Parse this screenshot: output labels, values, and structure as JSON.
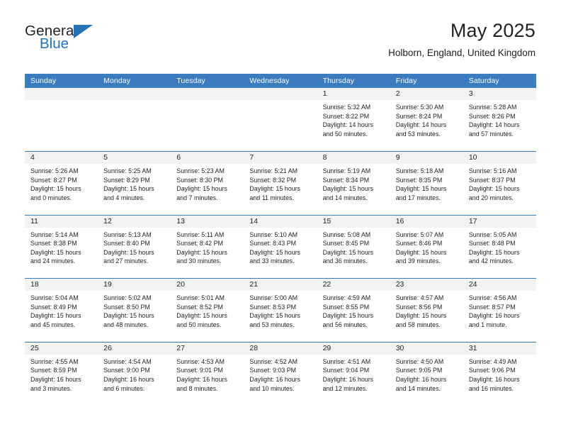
{
  "logo": {
    "word_one": "General",
    "word_two": "Blue",
    "triangle_icon": "triangle-icon",
    "accent_color": "#2572b5"
  },
  "header": {
    "title": "May 2025",
    "subtitle": "Holborn, England, United Kingdom"
  },
  "calendar": {
    "header_bg": "#3a7cbe",
    "daystrip_bg": "#f2f2f2",
    "weekday_headers": [
      "Sunday",
      "Monday",
      "Tuesday",
      "Wednesday",
      "Thursday",
      "Friday",
      "Saturday"
    ],
    "weeks": [
      [
        {
          "day": "",
          "empty": true
        },
        {
          "day": "",
          "empty": true
        },
        {
          "day": "",
          "empty": true
        },
        {
          "day": "",
          "empty": true
        },
        {
          "day": "1",
          "sunrise": "Sunrise: 5:32 AM",
          "sunset": "Sunset: 8:22 PM",
          "daylight_1": "Daylight: 14 hours",
          "daylight_2": "and 50 minutes."
        },
        {
          "day": "2",
          "sunrise": "Sunrise: 5:30 AM",
          "sunset": "Sunset: 8:24 PM",
          "daylight_1": "Daylight: 14 hours",
          "daylight_2": "and 53 minutes."
        },
        {
          "day": "3",
          "sunrise": "Sunrise: 5:28 AM",
          "sunset": "Sunset: 8:26 PM",
          "daylight_1": "Daylight: 14 hours",
          "daylight_2": "and 57 minutes."
        }
      ],
      [
        {
          "day": "4",
          "sunrise": "Sunrise: 5:26 AM",
          "sunset": "Sunset: 8:27 PM",
          "daylight_1": "Daylight: 15 hours",
          "daylight_2": "and 0 minutes."
        },
        {
          "day": "5",
          "sunrise": "Sunrise: 5:25 AM",
          "sunset": "Sunset: 8:29 PM",
          "daylight_1": "Daylight: 15 hours",
          "daylight_2": "and 4 minutes."
        },
        {
          "day": "6",
          "sunrise": "Sunrise: 5:23 AM",
          "sunset": "Sunset: 8:30 PM",
          "daylight_1": "Daylight: 15 hours",
          "daylight_2": "and 7 minutes."
        },
        {
          "day": "7",
          "sunrise": "Sunrise: 5:21 AM",
          "sunset": "Sunset: 8:32 PM",
          "daylight_1": "Daylight: 15 hours",
          "daylight_2": "and 11 minutes."
        },
        {
          "day": "8",
          "sunrise": "Sunrise: 5:19 AM",
          "sunset": "Sunset: 8:34 PM",
          "daylight_1": "Daylight: 15 hours",
          "daylight_2": "and 14 minutes."
        },
        {
          "day": "9",
          "sunrise": "Sunrise: 5:18 AM",
          "sunset": "Sunset: 8:35 PM",
          "daylight_1": "Daylight: 15 hours",
          "daylight_2": "and 17 minutes."
        },
        {
          "day": "10",
          "sunrise": "Sunrise: 5:16 AM",
          "sunset": "Sunset: 8:37 PM",
          "daylight_1": "Daylight: 15 hours",
          "daylight_2": "and 20 minutes."
        }
      ],
      [
        {
          "day": "11",
          "sunrise": "Sunrise: 5:14 AM",
          "sunset": "Sunset: 8:38 PM",
          "daylight_1": "Daylight: 15 hours",
          "daylight_2": "and 24 minutes."
        },
        {
          "day": "12",
          "sunrise": "Sunrise: 5:13 AM",
          "sunset": "Sunset: 8:40 PM",
          "daylight_1": "Daylight: 15 hours",
          "daylight_2": "and 27 minutes."
        },
        {
          "day": "13",
          "sunrise": "Sunrise: 5:11 AM",
          "sunset": "Sunset: 8:42 PM",
          "daylight_1": "Daylight: 15 hours",
          "daylight_2": "and 30 minutes."
        },
        {
          "day": "14",
          "sunrise": "Sunrise: 5:10 AM",
          "sunset": "Sunset: 8:43 PM",
          "daylight_1": "Daylight: 15 hours",
          "daylight_2": "and 33 minutes."
        },
        {
          "day": "15",
          "sunrise": "Sunrise: 5:08 AM",
          "sunset": "Sunset: 8:45 PM",
          "daylight_1": "Daylight: 15 hours",
          "daylight_2": "and 36 minutes."
        },
        {
          "day": "16",
          "sunrise": "Sunrise: 5:07 AM",
          "sunset": "Sunset: 8:46 PM",
          "daylight_1": "Daylight: 15 hours",
          "daylight_2": "and 39 minutes."
        },
        {
          "day": "17",
          "sunrise": "Sunrise: 5:05 AM",
          "sunset": "Sunset: 8:48 PM",
          "daylight_1": "Daylight: 15 hours",
          "daylight_2": "and 42 minutes."
        }
      ],
      [
        {
          "day": "18",
          "sunrise": "Sunrise: 5:04 AM",
          "sunset": "Sunset: 8:49 PM",
          "daylight_1": "Daylight: 15 hours",
          "daylight_2": "and 45 minutes."
        },
        {
          "day": "19",
          "sunrise": "Sunrise: 5:02 AM",
          "sunset": "Sunset: 8:50 PM",
          "daylight_1": "Daylight: 15 hours",
          "daylight_2": "and 48 minutes."
        },
        {
          "day": "20",
          "sunrise": "Sunrise: 5:01 AM",
          "sunset": "Sunset: 8:52 PM",
          "daylight_1": "Daylight: 15 hours",
          "daylight_2": "and 50 minutes."
        },
        {
          "day": "21",
          "sunrise": "Sunrise: 5:00 AM",
          "sunset": "Sunset: 8:53 PM",
          "daylight_1": "Daylight: 15 hours",
          "daylight_2": "and 53 minutes."
        },
        {
          "day": "22",
          "sunrise": "Sunrise: 4:59 AM",
          "sunset": "Sunset: 8:55 PM",
          "daylight_1": "Daylight: 15 hours",
          "daylight_2": "and 56 minutes."
        },
        {
          "day": "23",
          "sunrise": "Sunrise: 4:57 AM",
          "sunset": "Sunset: 8:56 PM",
          "daylight_1": "Daylight: 15 hours",
          "daylight_2": "and 58 minutes."
        },
        {
          "day": "24",
          "sunrise": "Sunrise: 4:56 AM",
          "sunset": "Sunset: 8:57 PM",
          "daylight_1": "Daylight: 16 hours",
          "daylight_2": "and 1 minute."
        }
      ],
      [
        {
          "day": "25",
          "sunrise": "Sunrise: 4:55 AM",
          "sunset": "Sunset: 8:59 PM",
          "daylight_1": "Daylight: 16 hours",
          "daylight_2": "and 3 minutes."
        },
        {
          "day": "26",
          "sunrise": "Sunrise: 4:54 AM",
          "sunset": "Sunset: 9:00 PM",
          "daylight_1": "Daylight: 16 hours",
          "daylight_2": "and 6 minutes."
        },
        {
          "day": "27",
          "sunrise": "Sunrise: 4:53 AM",
          "sunset": "Sunset: 9:01 PM",
          "daylight_1": "Daylight: 16 hours",
          "daylight_2": "and 8 minutes."
        },
        {
          "day": "28",
          "sunrise": "Sunrise: 4:52 AM",
          "sunset": "Sunset: 9:03 PM",
          "daylight_1": "Daylight: 16 hours",
          "daylight_2": "and 10 minutes."
        },
        {
          "day": "29",
          "sunrise": "Sunrise: 4:51 AM",
          "sunset": "Sunset: 9:04 PM",
          "daylight_1": "Daylight: 16 hours",
          "daylight_2": "and 12 minutes."
        },
        {
          "day": "30",
          "sunrise": "Sunrise: 4:50 AM",
          "sunset": "Sunset: 9:05 PM",
          "daylight_1": "Daylight: 16 hours",
          "daylight_2": "and 14 minutes."
        },
        {
          "day": "31",
          "sunrise": "Sunrise: 4:49 AM",
          "sunset": "Sunset: 9:06 PM",
          "daylight_1": "Daylight: 16 hours",
          "daylight_2": "and 16 minutes."
        }
      ]
    ]
  }
}
